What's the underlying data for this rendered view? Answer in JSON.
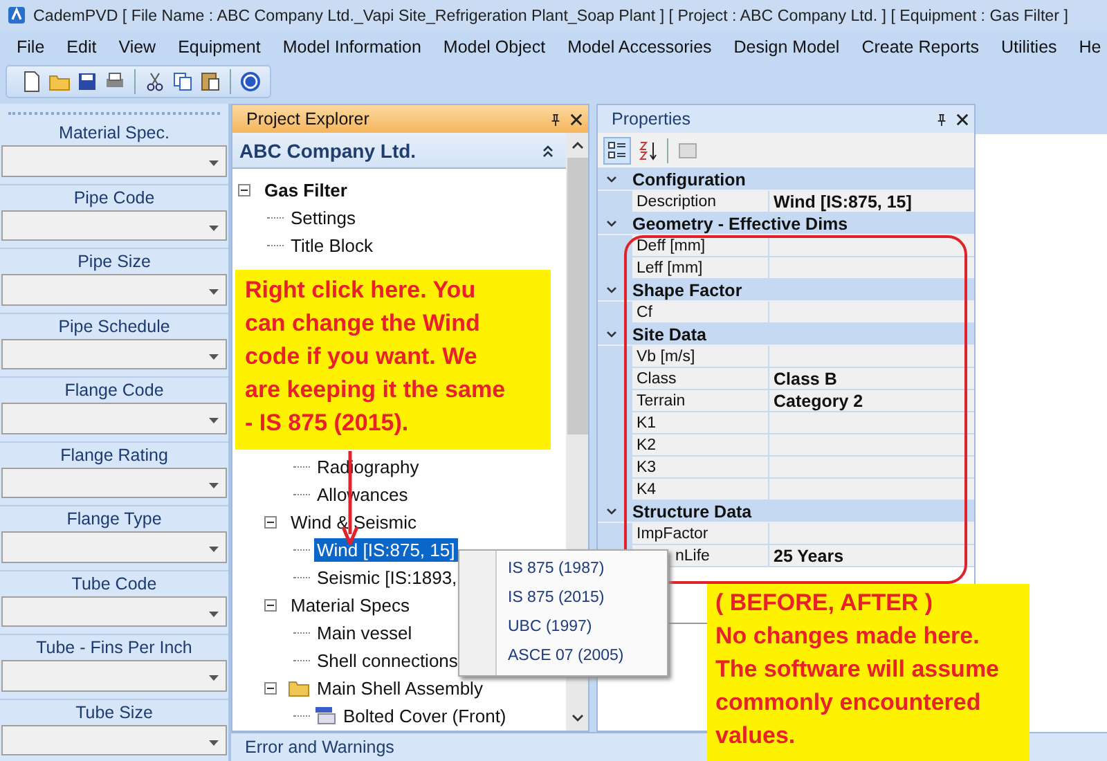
{
  "window": {
    "title": "CademPVD [ File Name : ABC Company Ltd._Vapi Site_Refrigeration Plant_Soap Plant ] [ Project : ABC Company Ltd. ] [ Equipment : Gas Filter ]"
  },
  "menu": [
    "File",
    "Edit",
    "View",
    "Equipment",
    "Model Information",
    "Model Object",
    "Model Accessories",
    "Design Model",
    "Create Reports",
    "Utilities",
    "He"
  ],
  "left_panel": {
    "fields": [
      {
        "label": "Material Spec."
      },
      {
        "label": "Pipe Code"
      },
      {
        "label": "Pipe Size"
      },
      {
        "label": "Pipe Schedule"
      },
      {
        "label": "Flange Code"
      },
      {
        "label": "Flange Rating"
      },
      {
        "label": "Flange Type"
      },
      {
        "label": "Tube Code"
      },
      {
        "label": "Tube - Fins Per Inch"
      },
      {
        "label": "Tube Size"
      }
    ]
  },
  "project_explorer": {
    "title": "Project Explorer",
    "header": "ABC Company Ltd.",
    "tree": [
      {
        "label": "Gas Filter",
        "kind": "root",
        "expanded": true,
        "selected": false,
        "children": [
          {
            "label": "Settings",
            "kind": "item",
            "selected": false
          },
          {
            "label": "Title Block",
            "kind": "item",
            "selected": false
          },
          {
            "kind": "covered",
            "children": [
              {
                "label": "Radiography",
                "kind": "item",
                "selected": false
              },
              {
                "label": "Allowances",
                "kind": "item",
                "selected": false
              }
            ]
          },
          {
            "label": "Wind & Seismic",
            "kind": "item",
            "expanded": true,
            "selected": false,
            "children": [
              {
                "label": "Wind [IS:875, 15]",
                "kind": "item",
                "selected": true
              },
              {
                "label": "Seismic [IS:1893,",
                "kind": "item",
                "selected": false
              }
            ]
          },
          {
            "label": "Material Specs",
            "kind": "item",
            "expanded": true,
            "selected": false,
            "children": [
              {
                "label": "Main vessel",
                "kind": "item",
                "selected": false
              },
              {
                "label": "Shell connections",
                "kind": "item",
                "selected": false
              }
            ]
          },
          {
            "label": "Main Shell Assembly",
            "kind": "folder",
            "expanded": true,
            "selected": false,
            "children": [
              {
                "label": "Bolted Cover (Front)",
                "kind": "part",
                "selected": false
              }
            ]
          }
        ]
      }
    ]
  },
  "properties": {
    "title": "Properties",
    "categories": [
      {
        "name": "Configuration",
        "expanded": true,
        "rows": [
          {
            "name": "Description",
            "value": "Wind [IS:875, 15]"
          }
        ]
      },
      {
        "name": "Geometry - Effective Dims",
        "expanded": true,
        "rows": [
          {
            "name": "Deff [mm]"
          },
          {
            "name": "Leff [mm]"
          }
        ]
      },
      {
        "name": "Shape Factor",
        "expanded": true,
        "rows": [
          {
            "name": "Cf"
          }
        ]
      },
      {
        "name": "Site Data",
        "expanded": true,
        "rows": [
          {
            "name": "Vb [m/s]"
          },
          {
            "name": "Class",
            "value": "Class B"
          },
          {
            "name": "Terrain",
            "value": "Category 2"
          },
          {
            "name": "K1"
          },
          {
            "name": "K2"
          },
          {
            "name": "K3"
          },
          {
            "name": "K4"
          }
        ]
      },
      {
        "name": "Structure Data",
        "expanded": true,
        "rows": [
          {
            "name": "ImpFactor"
          },
          {
            "name": "nLife",
            "value": "25 Years"
          }
        ]
      }
    ]
  },
  "context_menu": [
    "IS 875 (1987)",
    "IS 875 (2015)",
    "UBC (1997)",
    "ASCE 07 (2005)"
  ],
  "callouts": [
    {
      "text": "Right click here. You can change the Wind code if you want. We are keeping it the same - IS 875 (2015)."
    },
    {
      "heading": "( BEFORE, AFTER )",
      "text": "No changes made here. The software will assume commonly encountered values."
    }
  ],
  "bottom_panel": {
    "title": "Error and Warnings"
  }
}
